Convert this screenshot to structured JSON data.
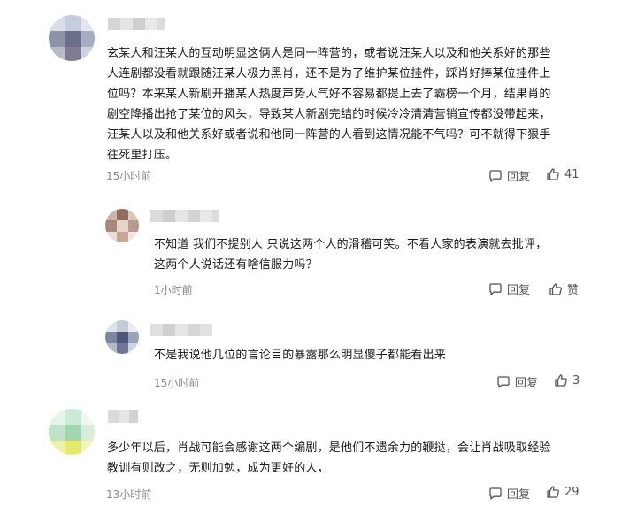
{
  "comments": [
    {
      "time": "15小时前",
      "text_lines": [
        "玄某人和汪某人的互动明显这俩人是同一阵营的，或者说汪某人以及和他关系好的那些",
        "人连剧都没看就跟随汪某人极力黑肖，还不是为了维护某位挂件，踩肖好捧某位挂件上",
        "位吗？本来某人新剧开播某人热度声势人气好不容易都提上去了霸榜一个月，结果肖的",
        "剧空降播出抢了某位的风头，导致某人新剧完结的时候冷冷清清营销宣传都没带起来，",
        "汪某人以及和他关系好或者说和他同一阵营的人看到这情况能不气吗？可不就得下狠手",
        "往死里打压。"
      ],
      "reply_label": "回复",
      "like_count": "41"
    },
    {
      "time": "1小时前",
      "text_lines": [
        "不知道 我们不提别人 只说这两个人的滑稽可笑。不看人家的表演就去批评，",
        "这两个人说话还有啥信服力吗？"
      ],
      "reply_label": "回复",
      "like_count": "赞"
    },
    {
      "time": "15小时前",
      "text_lines": [
        "不是我说他几位的言论目的暴露那么明显傻子都能看出来"
      ],
      "reply_label": "回复",
      "like_count": "3"
    },
    {
      "time": "13小时前",
      "text_lines": [
        "多少年以后，肖战可能会感谢这两个编剧，是他们不遗余力的鞭挞，会让肖战吸取经验",
        "教训有则改之，无则加勉，成为更好的人，"
      ],
      "reply_label": "回复",
      "like_count": "29"
    }
  ],
  "icons": {
    "reply": "comment-bubble-icon",
    "like": "thumbs-up-icon"
  }
}
